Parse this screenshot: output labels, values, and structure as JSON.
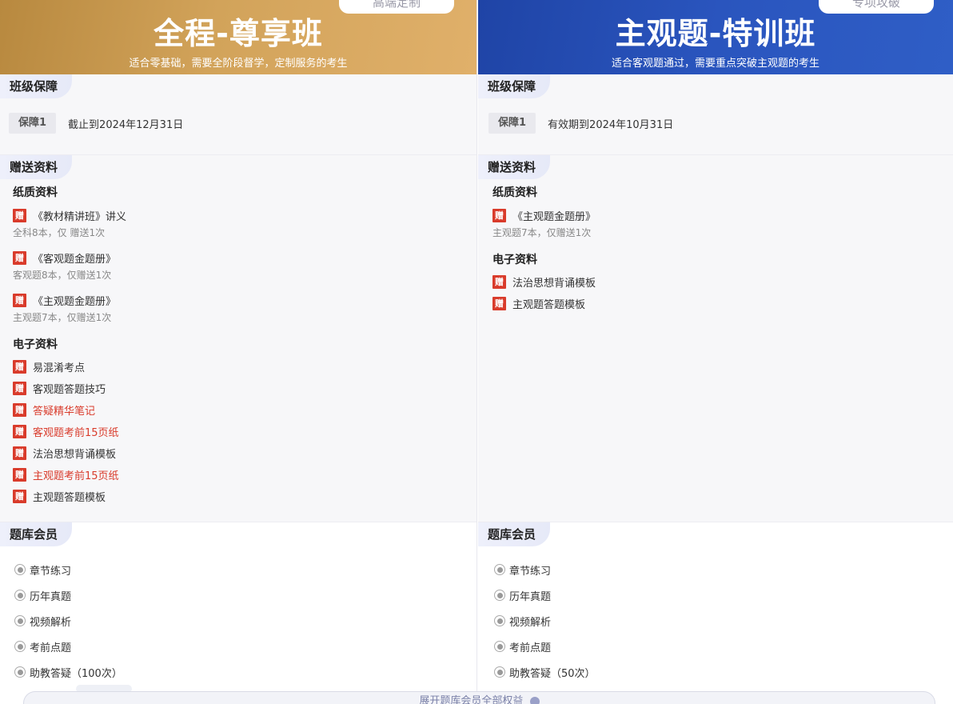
{
  "left": {
    "tag": "高端定制",
    "title": "全程-尊享班",
    "subtitle": "适合零基础，需要全阶段督学，定制服务的考生",
    "guarantee": {
      "label": "班级保障",
      "badge": "保障1",
      "text": "截止到2024年12月31日"
    },
    "gifts": {
      "label": "赠送资料",
      "badge": "赠",
      "paper_title": "纸质资料",
      "paper": [
        {
          "name": "《教材精讲班》讲义",
          "note": "全科8本，仅 赠送1次"
        },
        {
          "name": "《客观题金题册》",
          "note": "客观题8本，仅赠送1次"
        },
        {
          "name": "《主观题金题册》",
          "note": "主观题7本，仅赠送1次"
        }
      ],
      "e_title": "电子资料",
      "e": [
        {
          "name": "易混淆考点",
          "color": "#333333"
        },
        {
          "name": "客观题答题技巧",
          "color": "#333333"
        },
        {
          "name": "答疑精华笔记",
          "color": "#d93b2b"
        },
        {
          "name": "客观题考前15页纸",
          "color": "#d93b2b"
        },
        {
          "name": "法治思想背诵模板",
          "color": "#333333"
        },
        {
          "name": "主观题考前15页纸",
          "color": "#d93b2b"
        },
        {
          "name": "主观题答题模板",
          "color": "#333333"
        }
      ]
    },
    "bank": {
      "label": "题库会员",
      "items": [
        "章节练习",
        "历年真题",
        "视频解析",
        "考前点题",
        "助教答疑（100次）"
      ]
    }
  },
  "right": {
    "tag": "专项攻破",
    "title": "主观题-特训班",
    "subtitle": "适合客观题通过，需要重点突破主观题的考生",
    "guarantee": {
      "label": "班级保障",
      "badge": "保障1",
      "text": "有效期到2024年10月31日"
    },
    "gifts": {
      "label": "赠送资料",
      "badge": "赠",
      "paper_title": "纸质资料",
      "paper": [
        {
          "name": "《主观题金题册》",
          "note": "主观题7本，仅赠送1次"
        }
      ],
      "e_title": "电子资料",
      "e": [
        {
          "name": "法治思想背诵模板",
          "color": "#333333"
        },
        {
          "name": "主观题答题模板",
          "color": "#333333"
        }
      ]
    },
    "bank": {
      "label": "题库会员",
      "items": [
        "章节练习",
        "历年真题",
        "视频解析",
        "考前点题",
        "助教答疑（50次）"
      ]
    }
  },
  "expand": {
    "label": "展开题库会员全部权益"
  },
  "colors": {
    "gold": "#d2a35a",
    "blue": "#2a55be",
    "badge_red": "#d93b2b"
  }
}
